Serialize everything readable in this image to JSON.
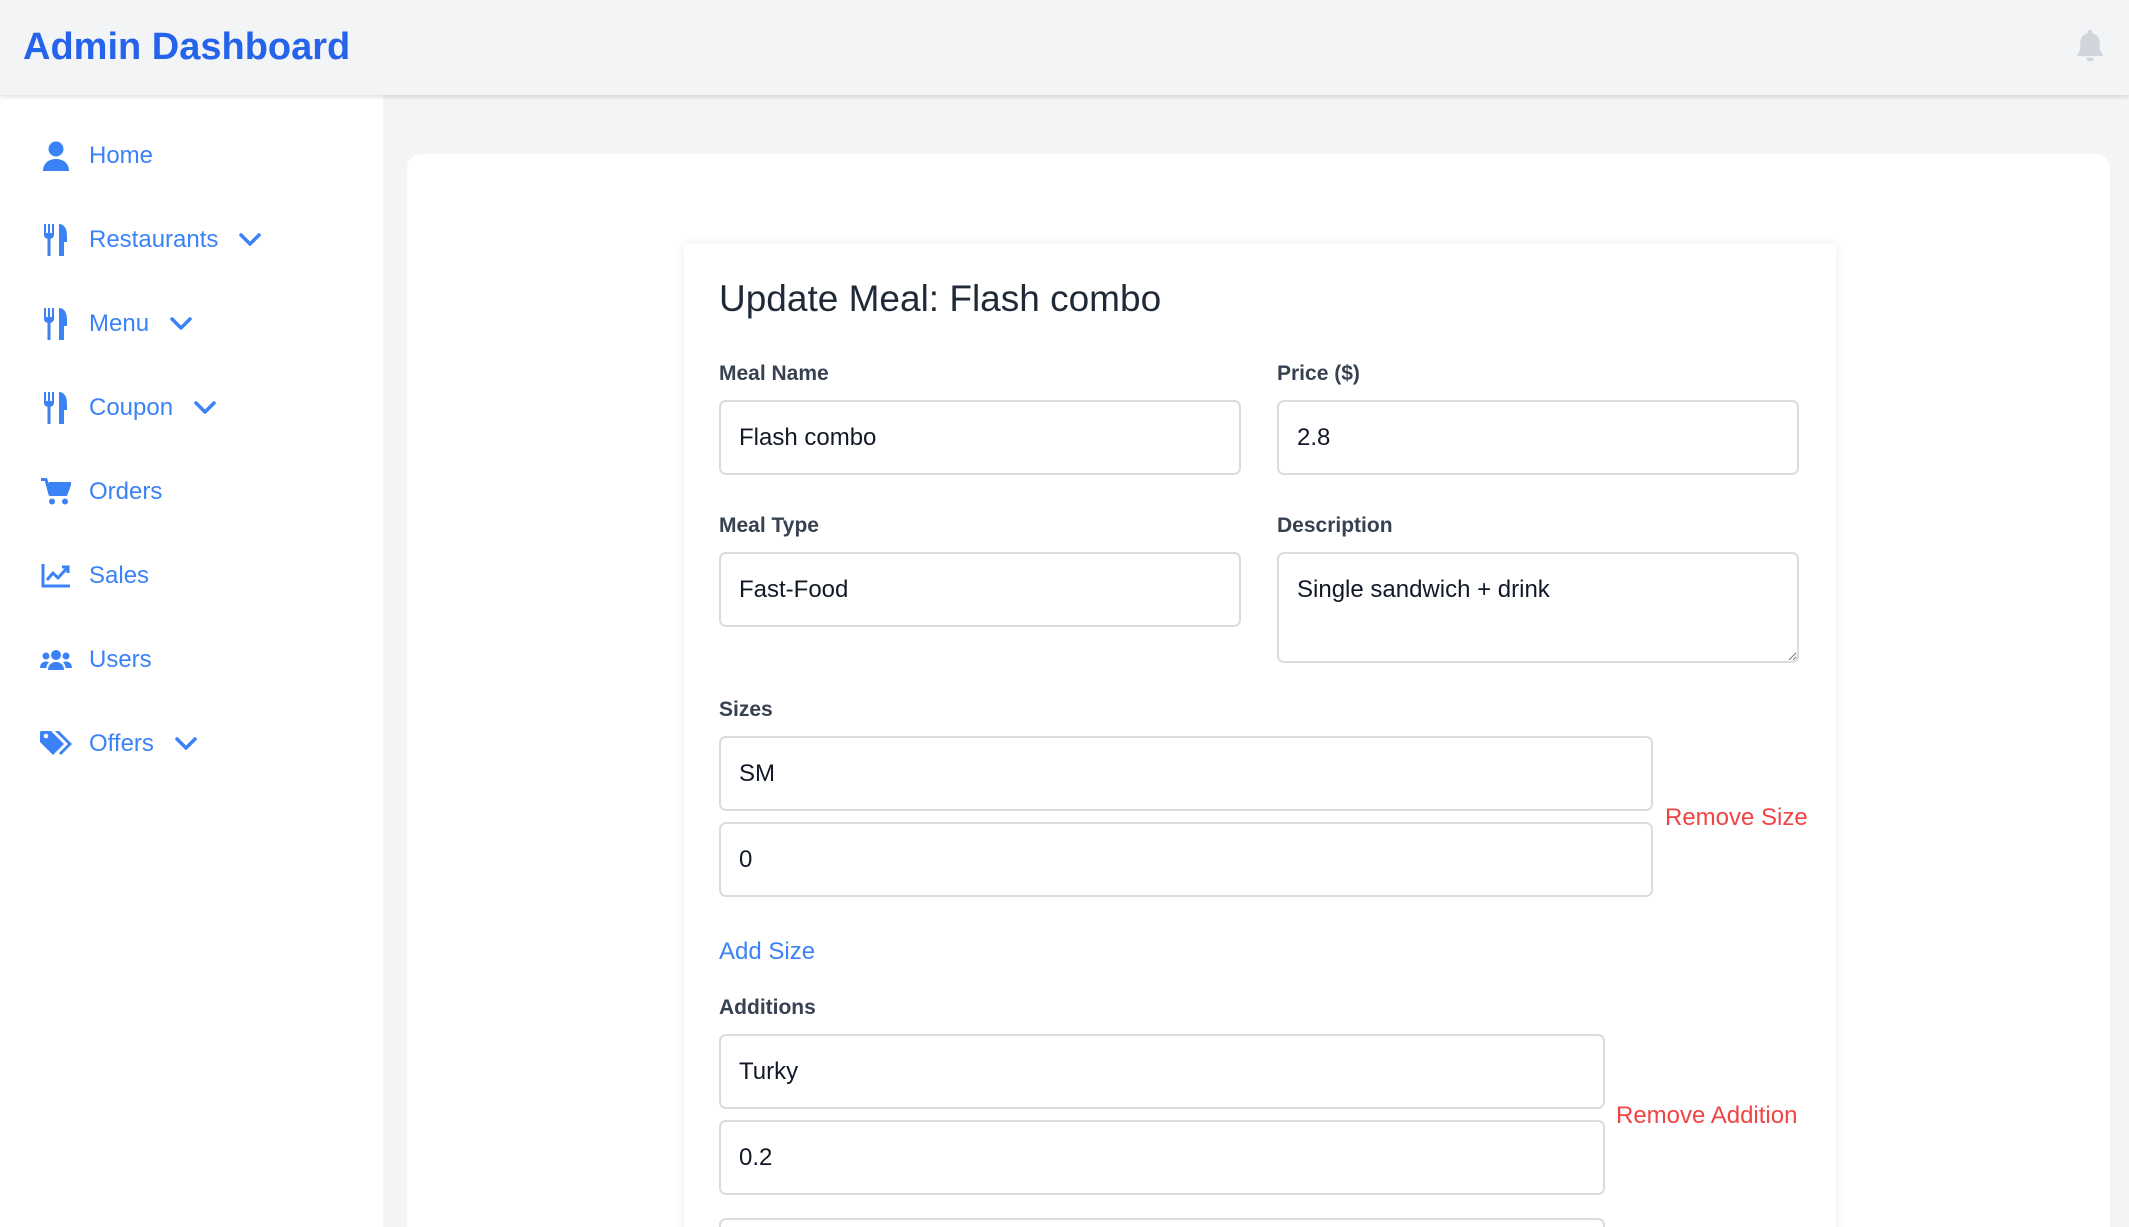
{
  "app": {
    "title": "Admin Dashboard"
  },
  "colors": {
    "brand": "#2563eb",
    "link": "#3b82f6",
    "danger": "#ef4444",
    "background": "#f3f4f6"
  },
  "sidebar": {
    "items": [
      {
        "label": "Home",
        "icon": "user-icon"
      },
      {
        "label": "Restaurants",
        "icon": "utensils-icon",
        "has_submenu": true
      },
      {
        "label": "Menu",
        "icon": "utensils-icon",
        "has_submenu": true
      },
      {
        "label": "Coupon",
        "icon": "utensils-icon",
        "has_submenu": true
      },
      {
        "label": "Orders",
        "icon": "cart-icon"
      },
      {
        "label": "Sales",
        "icon": "chart-line-icon"
      },
      {
        "label": "Users",
        "icon": "users-icon"
      },
      {
        "label": "Offers",
        "icon": "tags-icon",
        "has_submenu": true
      }
    ]
  },
  "form": {
    "title": "Update Meal: Flash combo",
    "meal_name": {
      "label": "Meal Name",
      "value": "Flash combo"
    },
    "price": {
      "label": "Price ($)",
      "value": "2.8"
    },
    "meal_type": {
      "label": "Meal Type",
      "value": "Fast-Food"
    },
    "description": {
      "label": "Description",
      "value": "Single sandwich + drink"
    },
    "sizes": {
      "label": "Sizes",
      "items": [
        {
          "name": "SM",
          "price": "0"
        }
      ],
      "remove_label": "Remove Size",
      "add_label": "Add Size"
    },
    "additions": {
      "label": "Additions",
      "items": [
        {
          "name": "Turky",
          "price": "0.2"
        }
      ],
      "remove_label": "Remove Addition"
    }
  }
}
